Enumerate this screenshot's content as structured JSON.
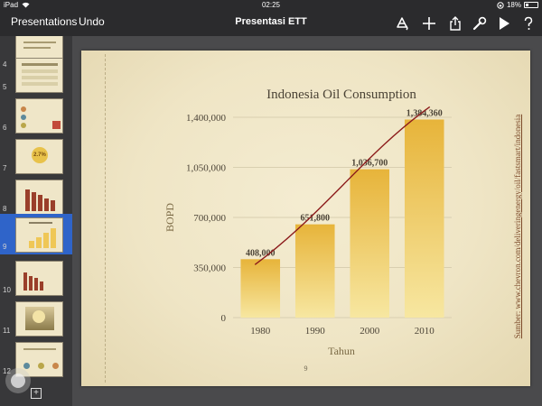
{
  "status": {
    "device": "iPad",
    "wifi_icon": "wifi-icon",
    "time": "02:25",
    "lock_icon": "orientation-lock-icon",
    "battery_text": "18%",
    "battery_level": 0.18
  },
  "toolbar": {
    "presentations_label": "Presentations",
    "undo_label": "Undo",
    "title": "Presentasi ETT",
    "icons": [
      "format-brush-icon",
      "add-icon",
      "share-icon",
      "wrench-icon",
      "play-icon",
      "help-icon"
    ]
  },
  "sidebar": {
    "slides": [
      {
        "num": "4",
        "selected": false
      },
      {
        "num": "5",
        "selected": false
      },
      {
        "num": "6",
        "selected": false
      },
      {
        "num": "7",
        "selected": false
      },
      {
        "num": "8",
        "selected": false
      },
      {
        "num": "9",
        "selected": true
      },
      {
        "num": "10",
        "selected": false
      },
      {
        "num": "11",
        "selected": false
      },
      {
        "num": "12",
        "selected": false
      }
    ],
    "thumb7_text": "2.7%",
    "add_slide_icon": "add-slide-icon"
  },
  "slide": {
    "page_number": "9",
    "source": "Sumber: www.chevron.com/deliveringenergy/oil/fastsmart/indonesia"
  },
  "chart_data": {
    "type": "bar",
    "title": "Indonesia Oil Consumption",
    "xlabel": "Tahun",
    "ylabel": "BOPD",
    "categories": [
      "1980",
      "1990",
      "2000",
      "2010"
    ],
    "values": [
      408000,
      651800,
      1036700,
      1384360
    ],
    "data_labels": [
      "408,000",
      "651,800",
      "1,036,700",
      "1,384,360"
    ],
    "yticks": [
      "0",
      "350,000",
      "700,000",
      "1,050,000",
      "1,400,000"
    ],
    "ylim": [
      0,
      1400000
    ],
    "grid": true,
    "trendline": true,
    "colors": {
      "bar_top": "#e7b43a",
      "bar_bottom": "#f7e7a1",
      "trend": "#8c1b1b",
      "grid": "#d9cfb0",
      "text": "#4b4336"
    }
  }
}
